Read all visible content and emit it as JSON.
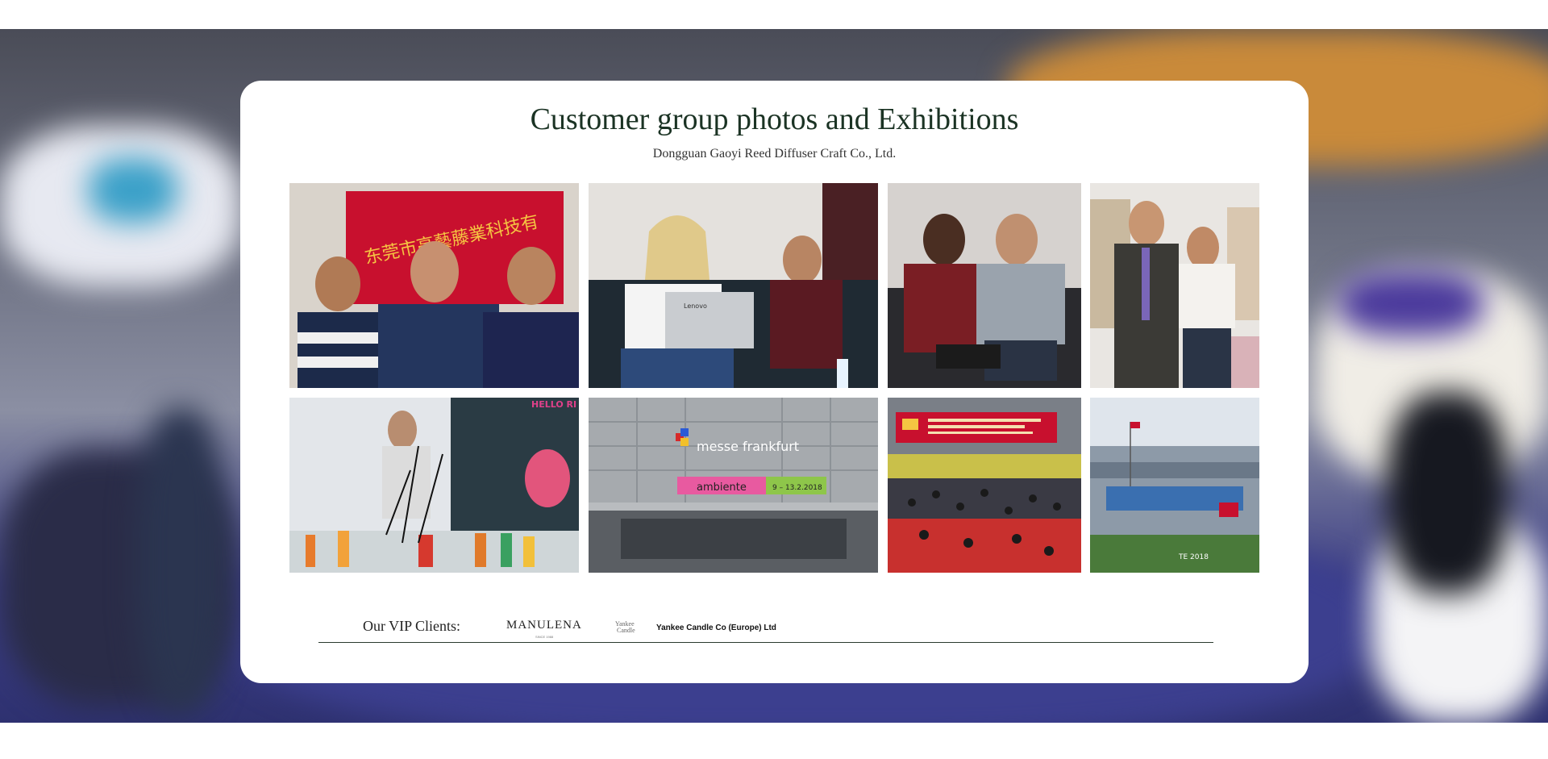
{
  "section": {
    "title": "Customer group photos and Exhibitions",
    "subtitle": "Dongguan Gaoyi Reed Diffuser Craft Co., Ltd."
  },
  "gallery": {
    "photos": [
      {
        "name": "photo-group-red-banner",
        "subject": "three men in front of red company banner",
        "banner_text": "东莞市高藝藤業科技有"
      },
      {
        "name": "photo-meeting-laptop",
        "subject": "woman with laptop and man on sofa",
        "laptop_text": "Lenovo"
      },
      {
        "name": "photo-two-men-sofa",
        "subject": "two men seated on sofa"
      },
      {
        "name": "photo-booth-visitors",
        "subject": "visitors looking at phones at booth"
      },
      {
        "name": "photo-diffuser-display",
        "subject": "reed diffuser display booth",
        "sign_text": "HELLO RI DIFFUS"
      },
      {
        "name": "photo-messe-frankfurt",
        "subject": "Messe Frankfurt entrance",
        "sign_text": "messe frankfurt",
        "banner_text": "ambiente",
        "date_text": "9 – 13.2.2018"
      },
      {
        "name": "photo-canton-fair",
        "subject": "crowd at Canton Fair with red banner"
      },
      {
        "name": "photo-exhibition-building",
        "subject": "exhibition center building",
        "sign_text": "TE 2018"
      }
    ]
  },
  "vip": {
    "label": "Our VIP Clients:",
    "clients": [
      {
        "logo_text": "MANULENA",
        "logo_sub": "SINCE 1988"
      },
      {
        "logo_text_top": "Yankee",
        "logo_text_bottom": "Candle"
      },
      {
        "name": "Yankee Candle Co (Europe) Ltd"
      }
    ]
  },
  "colors": {
    "title": "#1b3324",
    "rule": "#2a3a2e",
    "banner_red": "#c8102e"
  }
}
